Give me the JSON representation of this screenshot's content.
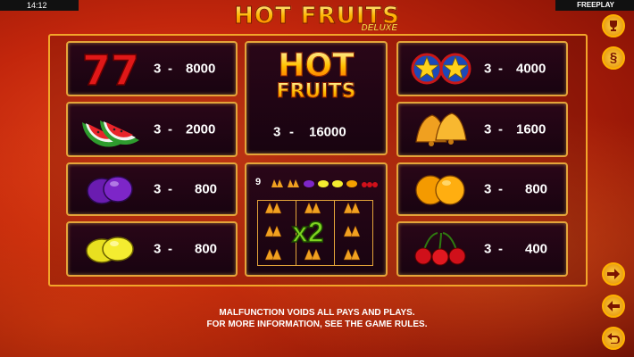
{
  "status_bar": {
    "time": "14:12",
    "mode": "FREEPLAY"
  },
  "logo": {
    "title": "HOT FRUITS",
    "subtitle": "DELUXE"
  },
  "paytable": {
    "left": [
      {
        "symbol": "seven",
        "count": "3",
        "dash": "-",
        "pay": "8000"
      },
      {
        "symbol": "watermelon",
        "count": "3",
        "dash": "-",
        "pay": "2000"
      },
      {
        "symbol": "plum",
        "count": "3",
        "dash": "-",
        "pay": "800"
      },
      {
        "symbol": "lemon",
        "count": "3",
        "dash": "-",
        "pay": "800"
      }
    ],
    "right": [
      {
        "symbol": "star",
        "count": "3",
        "dash": "-",
        "pay": "4000"
      },
      {
        "symbol": "bell",
        "count": "3",
        "dash": "-",
        "pay": "1600"
      },
      {
        "symbol": "orange",
        "count": "3",
        "dash": "-",
        "pay": "800"
      },
      {
        "symbol": "cherry",
        "count": "3",
        "dash": "-",
        "pay": "400"
      }
    ],
    "wild": {
      "line1": "HOT",
      "line2": "FRUITS",
      "count": "3",
      "dash": "-",
      "pay": "16000"
    },
    "bonus": {
      "count": "9",
      "multiplier": "x2"
    }
  },
  "footer": {
    "line1": "MALFUNCTION VOIDS ALL PAYS AND PLAYS.",
    "line2": "FOR MORE INFORMATION, SEE THE GAME RULES."
  },
  "side_buttons": {
    "section_symbol": "§"
  },
  "colors": {
    "accent": "#f2a52a",
    "cell_bg": "#1e0513",
    "background": "#c2260c"
  }
}
